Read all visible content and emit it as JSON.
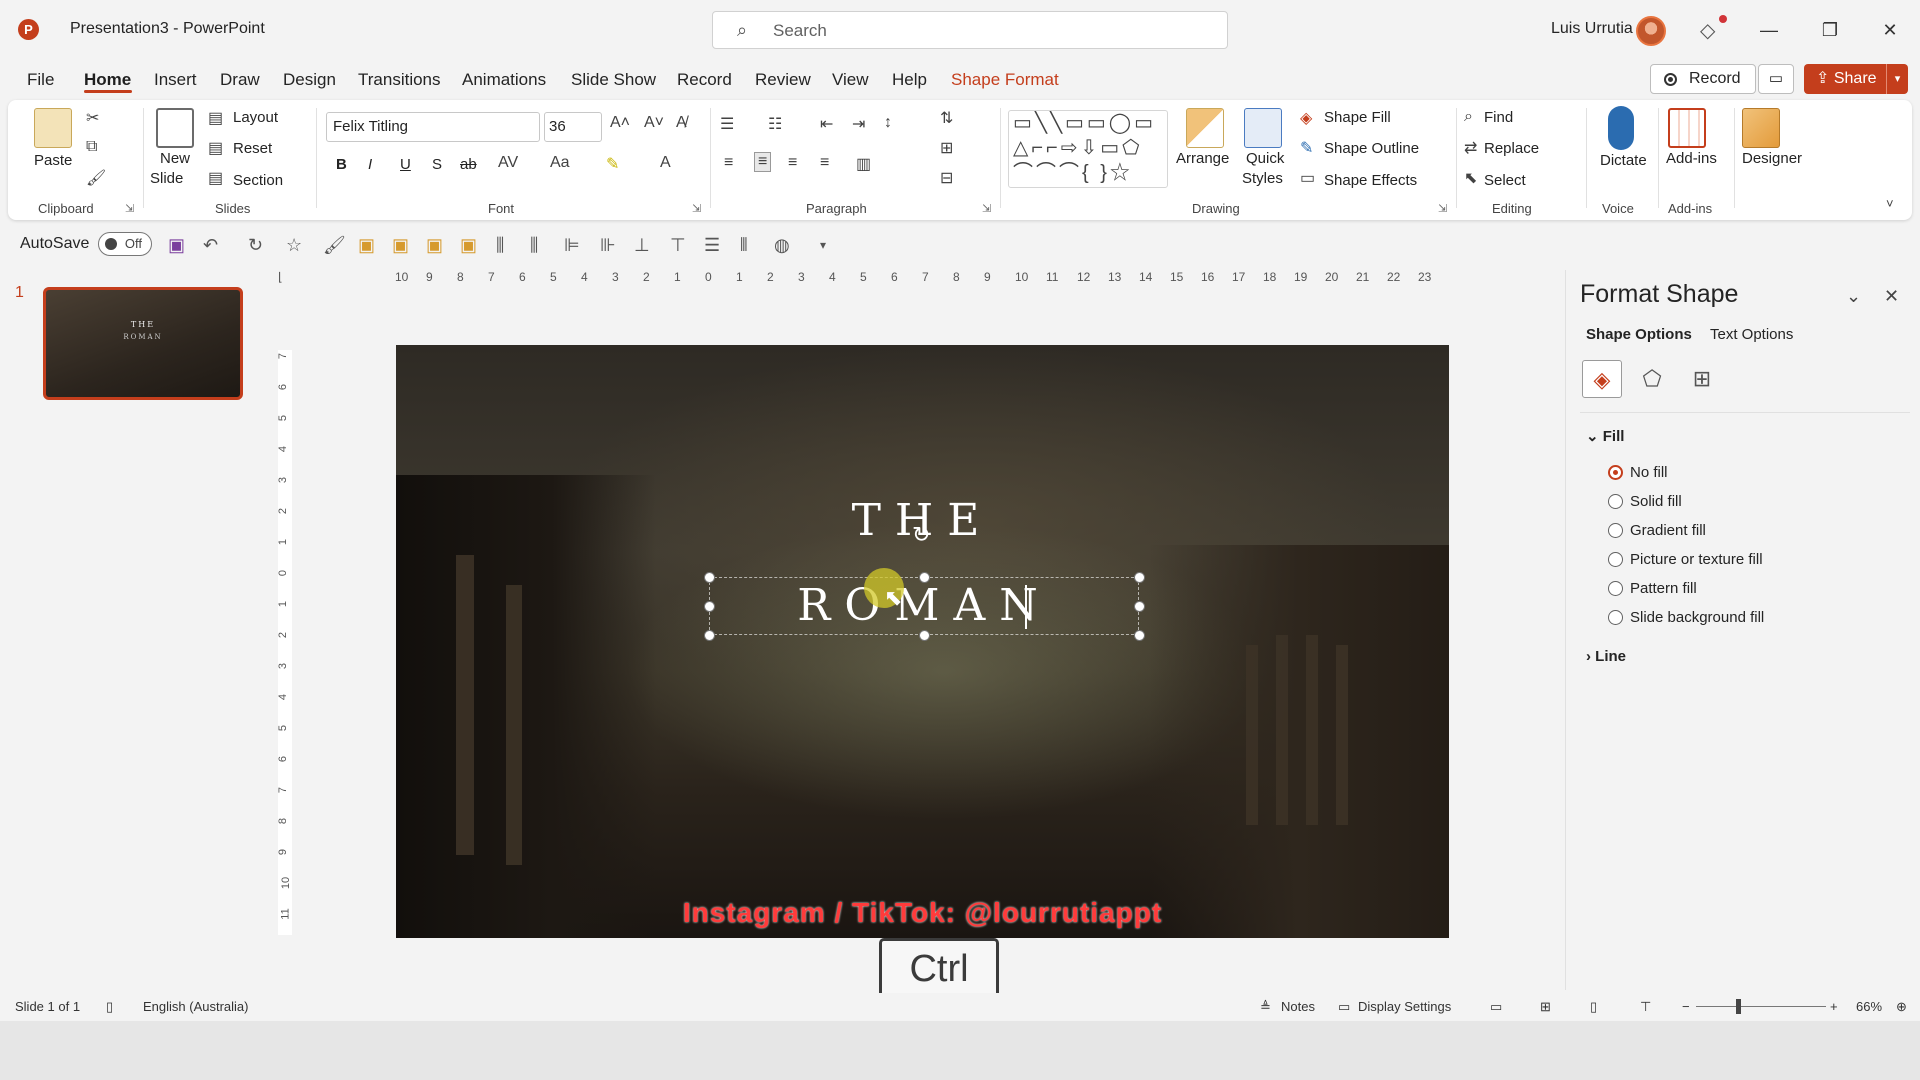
{
  "titlebar": {
    "app_logo": "P",
    "doc_title": "Presentation3  -  PowerPoint",
    "search_placeholder": "Search",
    "user_name": "Luis Urrutia"
  },
  "menu": {
    "tabs": [
      "File",
      "Home",
      "Insert",
      "Draw",
      "Design",
      "Transitions",
      "Animations",
      "Slide Show",
      "Record",
      "Review",
      "View",
      "Help",
      "Shape Format"
    ],
    "active_tab": "Home",
    "record_label": "Record",
    "share_label": "Share"
  },
  "ribbon": {
    "clipboard": {
      "paste": "Paste",
      "label": "Clipboard"
    },
    "slides": {
      "new_slide": "New",
      "new_slide_2": "Slide",
      "layout": "Layout",
      "reset": "Reset",
      "section": "Section",
      "label": "Slides"
    },
    "font": {
      "family": "Felix Titling",
      "size": "36",
      "label": "Font",
      "bold": "B",
      "italic": "I",
      "underline": "U",
      "shadow": "S",
      "strike": "ab"
    },
    "paragraph": {
      "label": "Paragraph"
    },
    "drawing": {
      "arrange": "Arrange",
      "quick": "Quick",
      "styles": "Styles",
      "shape_fill": "Shape Fill",
      "shape_outline": "Shape Outline",
      "shape_effects": "Shape Effects",
      "label": "Drawing"
    },
    "editing": {
      "find": "Find",
      "replace": "Replace",
      "select": "Select",
      "label": "Editing"
    },
    "voice": {
      "dictate": "Dictate",
      "label": "Voice"
    },
    "addins": {
      "addins": "Add-ins",
      "label": "Add-ins"
    },
    "designer": {
      "designer": "Designer"
    }
  },
  "qat": {
    "autosave_label": "AutoSave",
    "autosave_state": "Off"
  },
  "thumbnails": {
    "slide_number": "1",
    "thumb_line1": "THE",
    "thumb_line2": "ROMAN"
  },
  "ruler": {
    "h_ticks": [
      "10",
      "9",
      "8",
      "7",
      "6",
      "5",
      "4",
      "3",
      "2",
      "1",
      "0",
      "1",
      "2",
      "3",
      "4",
      "5",
      "6",
      "7",
      "8",
      "9",
      "10",
      "11",
      "12",
      "13",
      "14",
      "15",
      "16",
      "17",
      "18",
      "19",
      "20",
      "21",
      "22",
      "23"
    ],
    "v_ticks": [
      "7",
      "6",
      "5",
      "4",
      "3",
      "2",
      "1",
      "0",
      "1",
      "2",
      "3",
      "4",
      "5",
      "6",
      "7",
      "8",
      "9",
      "10",
      "11"
    ]
  },
  "slide": {
    "title_line1": "THE",
    "title_line2": "ROMAN",
    "watermark": "Instagram / TikTok: @lourrutiappt"
  },
  "overlay": {
    "key_label": "Ctrl"
  },
  "format_pane": {
    "title": "Format Shape",
    "tabs": [
      "Shape Options",
      "Text Options"
    ],
    "active_tab": "Shape Options",
    "fill_header": "Fill",
    "fill_options": [
      "No fill",
      "Solid fill",
      "Gradient fill",
      "Picture or texture fill",
      "Pattern fill",
      "Slide background fill"
    ],
    "selected_fill": "No fill",
    "line_header": "Line"
  },
  "statusbar": {
    "slide_info": "Slide 1 of 1",
    "language": "English (Australia)",
    "notes": "Notes",
    "display_settings": "Display Settings",
    "zoom": "66%"
  },
  "colors": {
    "accent": "#c43e1c",
    "watermark": "#ff3b3b"
  }
}
